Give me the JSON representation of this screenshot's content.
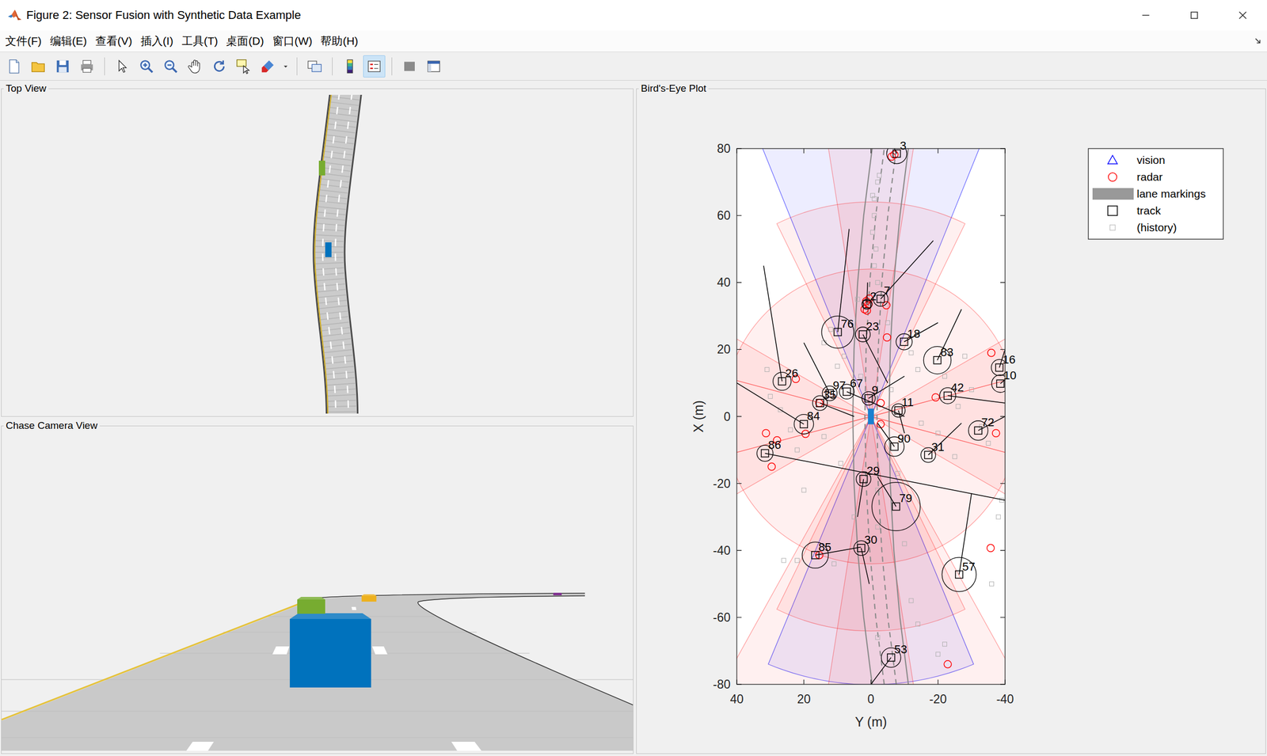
{
  "window": {
    "title": "Figure 2: Sensor Fusion with Synthetic Data Example"
  },
  "menu": [
    "文件(F)",
    "编辑(E)",
    "查看(V)",
    "插入(I)",
    "工具(T)",
    "桌面(D)",
    "窗口(W)",
    "帮助(H)"
  ],
  "toolbar": [
    {
      "kind": "new",
      "selected": false
    },
    {
      "kind": "open",
      "selected": false
    },
    {
      "kind": "save",
      "selected": false
    },
    {
      "kind": "print",
      "selected": false
    },
    {
      "kind": "separator",
      "selected": false
    },
    {
      "kind": "pointer",
      "selected": false
    },
    {
      "kind": "zoom-in",
      "selected": false
    },
    {
      "kind": "zoom-out",
      "selected": false
    },
    {
      "kind": "pan",
      "selected": false
    },
    {
      "kind": "rotate",
      "selected": false
    },
    {
      "kind": "datatip",
      "selected": false
    },
    {
      "kind": "brush",
      "selected": false
    },
    {
      "kind": "dropdown",
      "selected": false
    },
    {
      "kind": "separator",
      "selected": false
    },
    {
      "kind": "link",
      "selected": false
    },
    {
      "kind": "separator",
      "selected": false
    },
    {
      "kind": "colorbar",
      "selected": false
    },
    {
      "kind": "legend",
      "selected": true
    },
    {
      "kind": "separator",
      "selected": false
    },
    {
      "kind": "hide-tools",
      "selected": false
    },
    {
      "kind": "show-tools",
      "selected": false
    }
  ],
  "panels": {
    "top_view": {
      "title": "Top View",
      "actors": [
        {
          "color": "#77ac30"
        },
        {
          "color": "#0072bd"
        }
      ]
    },
    "chase_view": {
      "title": "Chase Camera View",
      "actors": [
        {
          "color": "#0072bd"
        },
        {
          "color": "#77ac30"
        },
        {
          "color": "#edb120"
        },
        {
          "color": "#7e2f8e"
        }
      ]
    },
    "birds_eye": {
      "title": "Bird's-Eye Plot",
      "x_label": "X (m)",
      "y_label": "Y (m)",
      "x_ticks": [
        "80",
        "60",
        "40",
        "20",
        "0",
        "-20",
        "-40",
        "-60",
        "-80"
      ],
      "y_ticks": [
        "40",
        "20",
        "0",
        "-20",
        "-40"
      ],
      "legend": [
        {
          "label": "vision",
          "kind": "triangle",
          "color": "#0000ff"
        },
        {
          "label": "radar",
          "kind": "circle",
          "color": "#ff0000"
        },
        {
          "label": "lane markings",
          "kind": "band",
          "color": "#999999"
        },
        {
          "label": "track",
          "kind": "square",
          "color": "#000000"
        },
        {
          "label": "(history)",
          "kind": "small-square",
          "color": "#b0b0b0"
        }
      ],
      "sensors": [
        {
          "kind": "vision",
          "heading": 0,
          "fov": 44,
          "range": 150,
          "color": "#0000ff"
        },
        {
          "kind": "vision",
          "heading": 180,
          "fov": 45,
          "range": 80,
          "color": "#0000ff"
        },
        {
          "kind": "radar",
          "heading": 0,
          "fov": 18,
          "range": 174,
          "color": "#ff0000"
        },
        {
          "kind": "radar",
          "heading": 0,
          "fov": 52,
          "range": 64,
          "color": "#ff0000"
        },
        {
          "kind": "radar",
          "heading": 0,
          "fov": 150,
          "range": 44,
          "color": "#ff0000"
        },
        {
          "kind": "radar",
          "heading": 180,
          "fov": 150,
          "range": 44,
          "color": "#ff0000"
        },
        {
          "kind": "radar",
          "heading": 180,
          "fov": 52,
          "range": 64,
          "color": "#ff0000"
        },
        {
          "kind": "radar",
          "heading": 180,
          "fov": 18,
          "range": 174,
          "color": "#ff0000"
        },
        {
          "kind": "radar",
          "heading": 180,
          "fov": 58,
          "range": 90,
          "color": "#ff0000"
        },
        {
          "kind": "radar",
          "heading": 90,
          "fov": 60,
          "range": 60,
          "color": "#ff0000"
        },
        {
          "kind": "radar",
          "heading": 90,
          "fov": 30,
          "range": 80,
          "color": "#ff0000"
        },
        {
          "kind": "radar",
          "heading": -90,
          "fov": 60,
          "range": 60,
          "color": "#ff0000"
        },
        {
          "kind": "radar",
          "heading": -90,
          "fov": 30,
          "range": 80,
          "color": "#ff0000"
        }
      ],
      "lanes": {
        "x": [
          -80,
          -60,
          -40,
          -20,
          0,
          20,
          40,
          60,
          80
        ],
        "lines": [
          {
            "y": [
              -0.36,
              2.16,
              3.96,
              5.04,
              5.4,
              5.04,
              3.96,
              2.16,
              -0.36
            ],
            "dashed": false
          },
          {
            "y": [
              -3.96,
              -1.44,
              0.36,
              1.44,
              1.8,
              1.44,
              0.36,
              -1.44,
              -3.96
            ],
            "dashed": true
          },
          {
            "y": [
              -7.56,
              -5.04,
              -3.24,
              -2.16,
              -1.8,
              -2.16,
              -3.24,
              -5.04,
              -7.56
            ],
            "dashed": true
          },
          {
            "y": [
              -11.16,
              -8.64,
              -6.84,
              -5.76,
              -5.4,
              -5.76,
              -6.84,
              -8.64,
              -11.16
            ],
            "dashed": false
          }
        ]
      },
      "ego": {
        "x": 0,
        "y": 0,
        "length": 4.7,
        "width": 1.8,
        "color": "#1a80d0"
      },
      "tracks": [
        {
          "id": "3",
          "x": 78.5,
          "y": -7.7,
          "r": 3.0,
          "to": [
            80,
            -7.0
          ]
        },
        {
          "id": "7",
          "x": 35.1,
          "y": -2.9,
          "r": 2.2,
          "to": [
            52.5,
            -18.6
          ]
        },
        {
          "id": "2",
          "x": 33.5,
          "y": 1.2,
          "r": 1.5,
          "to": [
            40,
            1.0
          ]
        },
        {
          "id": "76",
          "x": 25.2,
          "y": 9.9,
          "r": 4.8,
          "to": [
            56,
            6.5
          ]
        },
        {
          "id": "23",
          "x": 24.5,
          "y": 2.4,
          "r": 2.2,
          "to": [
            10,
            -5
          ]
        },
        {
          "id": "18",
          "x": 22.3,
          "y": -9.9,
          "r": 2.4,
          "to": [
            28,
            -20
          ]
        },
        {
          "id": "83",
          "x": 16.8,
          "y": -19.8,
          "r": 4.1,
          "to": [
            32,
            -27
          ]
        },
        {
          "id": "16",
          "x": 14.6,
          "y": -38.3,
          "r": 2.4,
          "to": [
            20,
            -40
          ]
        },
        {
          "id": "10",
          "x": 9.8,
          "y": -38.6,
          "r": 2.6,
          "to": [
            11,
            -40
          ]
        },
        {
          "id": "26",
          "x": 10.5,
          "y": 26.5,
          "r": 2.7,
          "to": [
            45,
            32
          ]
        },
        {
          "id": "97",
          "x": 6.9,
          "y": 12.3,
          "r": 2.2,
          "to": [
            22,
            20
          ]
        },
        {
          "id": "67",
          "x": 7.4,
          "y": 7.2,
          "r": 2.2,
          "to": [
            0,
            -10
          ]
        },
        {
          "id": "35",
          "x": 4.0,
          "y": 15.2,
          "r": 2.2,
          "to": [
            0,
            5
          ]
        },
        {
          "id": "9",
          "x": 5.4,
          "y": 0.7,
          "r": 2.0,
          "to": [
            12,
            -10
          ]
        },
        {
          "id": "42",
          "x": 6.2,
          "y": -22.9,
          "r": 2.4,
          "to": [
            4,
            -40
          ]
        },
        {
          "id": "11",
          "x": 1.8,
          "y": -8.2,
          "r": 2.0,
          "to": [
            -5,
            -10
          ]
        },
        {
          "id": "84",
          "x": -2.3,
          "y": 20.0,
          "r": 2.9,
          "to": [
            10,
            40
          ]
        },
        {
          "id": "72",
          "x": -4.2,
          "y": -32.0,
          "r": 2.9,
          "to": [
            0,
            -40
          ]
        },
        {
          "id": "86",
          "x": -11.0,
          "y": 31.6,
          "r": 2.4,
          "to": [
            -25,
            -40
          ]
        },
        {
          "id": "90",
          "x": -9.0,
          "y": -7.0,
          "r": 2.9,
          "to": [
            -2,
            -2
          ]
        },
        {
          "id": "31",
          "x": -11.5,
          "y": -17.1,
          "r": 2.2,
          "to": [
            -2,
            -27
          ]
        },
        {
          "id": "29",
          "x": -18.7,
          "y": 2.2,
          "r": 2.2,
          "to": [
            -30,
            4
          ]
        },
        {
          "id": "79",
          "x": -26.9,
          "y": -7.5,
          "r": 7.2,
          "to": [
            -18,
            -2
          ]
        },
        {
          "id": "85",
          "x": -41.4,
          "y": 16.6,
          "r": 3.9,
          "to": [
            -39,
            3
          ]
        },
        {
          "id": "30",
          "x": -39.3,
          "y": 2.9,
          "r": 2.2,
          "to": [
            -50,
            0.5
          ]
        },
        {
          "id": "57",
          "x": -47.2,
          "y": -26.3,
          "r": 5.1,
          "to": [
            -23,
            -30
          ]
        },
        {
          "id": "53",
          "x": -72.0,
          "y": -6.0,
          "r": 2.9,
          "to": [
            -80,
            0
          ]
        }
      ],
      "radar": [
        [
          78.2,
          -7.0
        ],
        [
          77.6,
          -6.2
        ],
        [
          34.4,
          1.4
        ],
        [
          33.5,
          0.7
        ],
        [
          32.0,
          1.9
        ],
        [
          35.2,
          0.5
        ],
        [
          31.6,
          1.2
        ],
        [
          33.2,
          -4.6
        ],
        [
          23.6,
          -4.8
        ],
        [
          19.0,
          -35.9
        ],
        [
          11.2,
          22.4
        ],
        [
          5.7,
          -19.3
        ],
        [
          4.0,
          -2.9
        ],
        [
          4.0,
          15.4
        ],
        [
          -5.0,
          31.3
        ],
        [
          -7.1,
          28.0
        ],
        [
          -5.2,
          19.5
        ],
        [
          -15.0,
          29.6
        ],
        [
          -5.0,
          -37.3
        ],
        [
          -39.3,
          -35.7
        ],
        [
          -74.0,
          -22.9
        ],
        [
          -41.4,
          15.4
        ],
        [
          -2.3,
          -2.9
        ]
      ],
      "history": [
        [
          60,
          -1
        ],
        [
          55,
          -0.5
        ],
        [
          50,
          -1.5
        ],
        [
          65,
          -1
        ],
        [
          70,
          -2
        ],
        [
          45,
          -1
        ],
        [
          28,
          -5
        ],
        [
          26,
          12
        ],
        [
          22,
          14
        ],
        [
          18,
          8
        ],
        [
          15,
          10
        ],
        [
          12,
          3
        ],
        [
          8,
          -6
        ],
        [
          14,
          -14
        ],
        [
          19,
          -12
        ],
        [
          12,
          -22
        ],
        [
          8,
          -30
        ],
        [
          3,
          -26
        ],
        [
          -2,
          -15
        ],
        [
          -5,
          -20
        ],
        [
          -3,
          -33
        ],
        [
          -8,
          -35
        ],
        [
          -12,
          -25
        ],
        [
          -17,
          -8
        ],
        [
          -22,
          -2
        ],
        [
          -14,
          9
        ],
        [
          -6,
          14
        ],
        [
          -4,
          24
        ],
        [
          2,
          27
        ],
        [
          6,
          30
        ],
        [
          14,
          31
        ],
        [
          -10,
          22
        ],
        [
          -22,
          20
        ],
        [
          -30,
          5
        ],
        [
          -33,
          -2
        ],
        [
          -38,
          -10
        ],
        [
          -43,
          22
        ],
        [
          -43,
          26
        ],
        [
          -44,
          11
        ],
        [
          -55,
          -12
        ],
        [
          -62,
          -14
        ],
        [
          -66,
          -2
        ],
        [
          -71,
          -20
        ],
        [
          -68,
          -22
        ],
        [
          -25,
          -39
        ],
        [
          -30,
          -38
        ],
        [
          -50,
          -36
        ],
        [
          18,
          -28
        ],
        [
          35,
          4
        ],
        [
          40,
          -2
        ],
        [
          66,
          -0.5
        ],
        [
          72,
          -2.5
        ]
      ]
    }
  }
}
